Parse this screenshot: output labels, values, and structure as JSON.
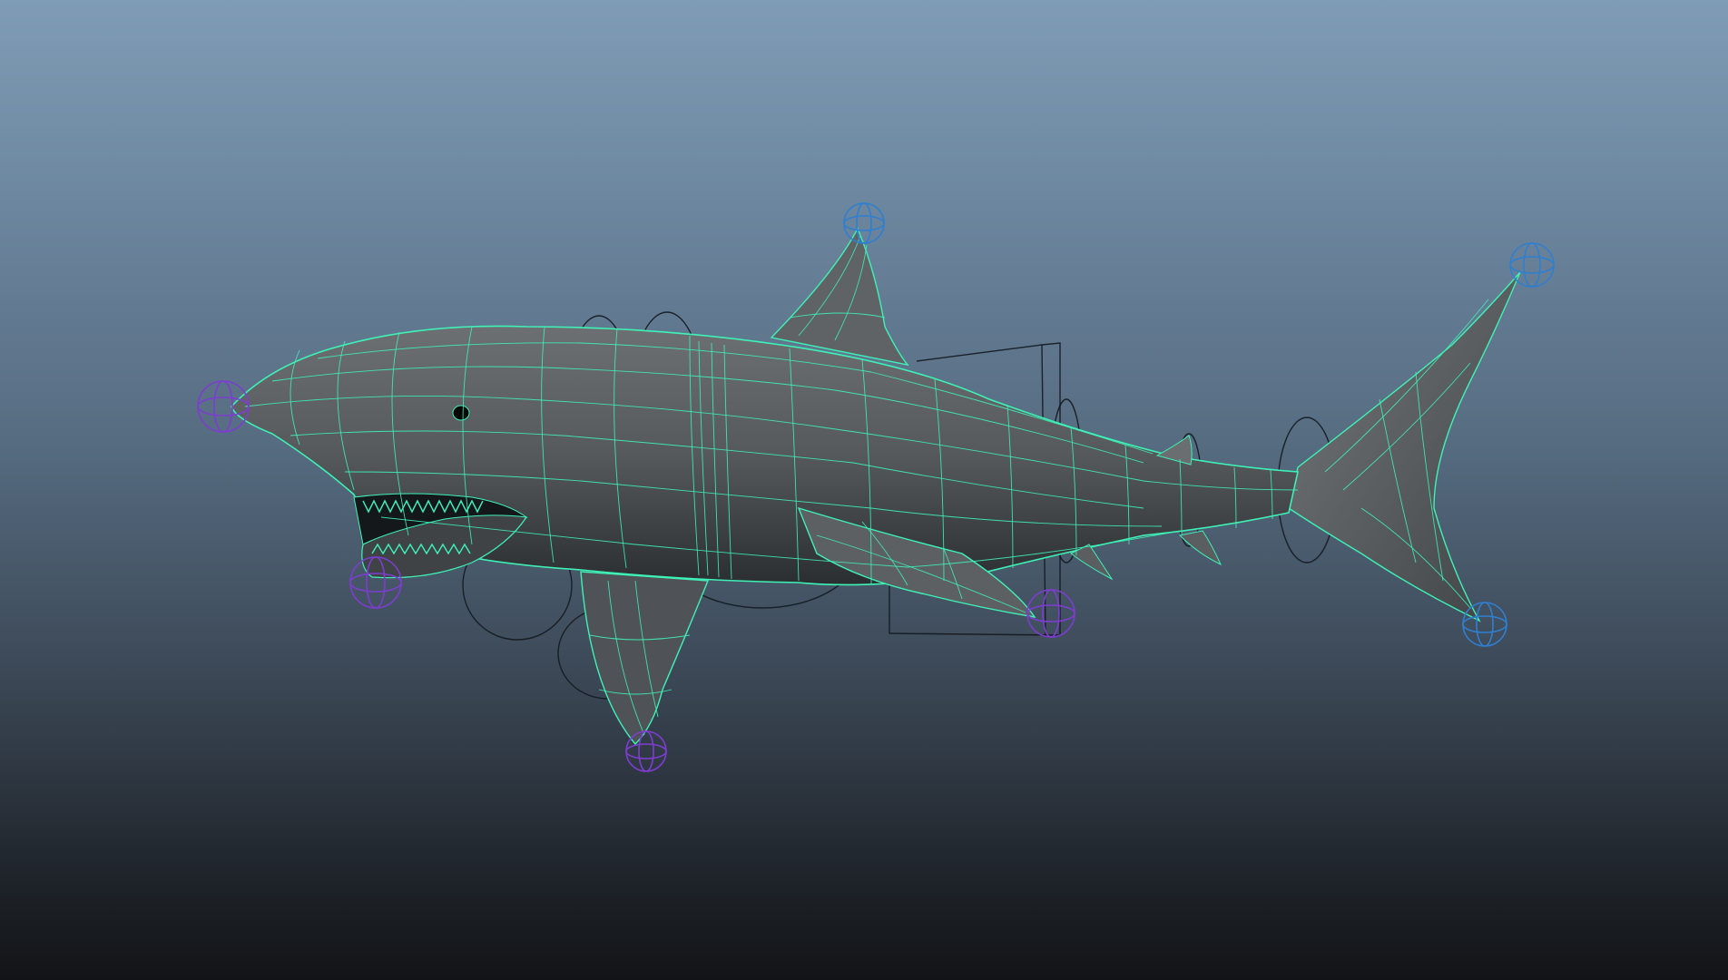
{
  "viewport": {
    "background_top": "#7f9cb6",
    "background_bottom": "#121417",
    "wireframe_color": "#3ef2b6",
    "mesh_color": "#5a5f63",
    "locator_blue": "#2f7fd0",
    "locator_purple": "#7d3dd0",
    "control_curve_color": "#14181f"
  },
  "icons": {
    "model": "shark-mesh-icon"
  }
}
